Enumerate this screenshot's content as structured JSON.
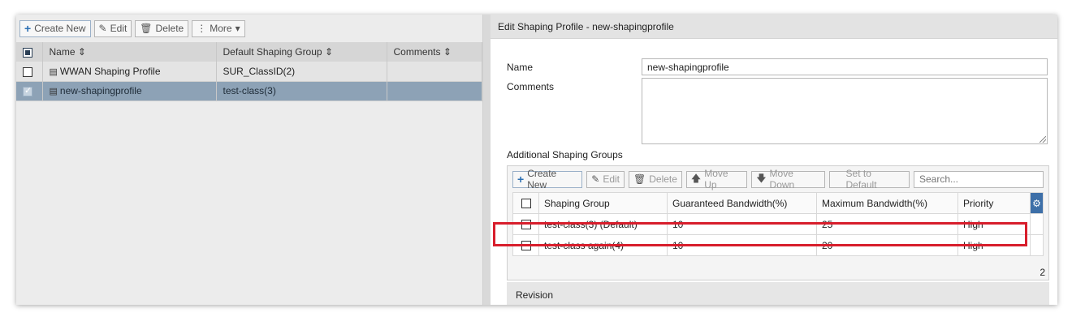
{
  "left_toolbar": {
    "create_new": "Create New",
    "edit": "Edit",
    "delete": "Delete",
    "more": "More"
  },
  "left_table": {
    "columns": [
      "Name",
      "Default Shaping Group",
      "Comments"
    ],
    "rows": [
      {
        "name": "WWAN Shaping Profile",
        "group": "SUR_ClassID(2)",
        "comments": ""
      },
      {
        "name": "new-shapingprofile",
        "group": "test-class(3)",
        "comments": ""
      }
    ]
  },
  "panel": {
    "title": "Edit Shaping Profile - new-shapingprofile",
    "name_label": "Name",
    "name_value": "new-shapingprofile",
    "comments_label": "Comments",
    "comments_value": "",
    "groups_label": "Additional Shaping Groups",
    "revision_label": "Revision"
  },
  "group_toolbar": {
    "create_new": "Create New",
    "edit": "Edit",
    "delete": "Delete",
    "move_up": "Move Up",
    "move_down": "Move Down",
    "set_default": "Set to Default",
    "search_placeholder": "Search..."
  },
  "group_table": {
    "columns": [
      "Shaping Group",
      "Guaranteed Bandwidth(%)",
      "Maximum Bandwidth(%)",
      "Priority"
    ],
    "rows": [
      {
        "group": "test-class(3) (Default)",
        "guaranteed": "10",
        "maximum": "25",
        "priority": "High"
      },
      {
        "group": "test-class again(4)",
        "guaranteed": "10",
        "maximum": "20",
        "priority": "High"
      }
    ],
    "count": "2"
  },
  "colors": {
    "highlight": "#d81e2c",
    "selected_row": "#8da2b6",
    "accent": "#3d6fa8"
  }
}
